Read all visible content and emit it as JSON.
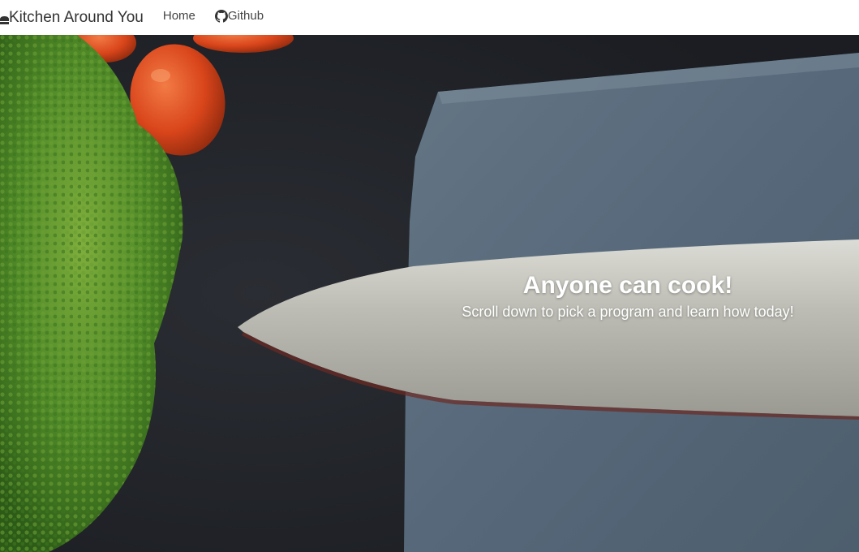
{
  "nav": {
    "brand_label": "Kitchen Around You",
    "brand_icon": "chef-hat-icon",
    "links": [
      {
        "label": "Home",
        "icon": null
      },
      {
        "label": "Github",
        "icon": "github-icon"
      }
    ]
  },
  "hero": {
    "title": "Anyone can cook!",
    "subtitle": "Scroll down to pick a program and learn how today!",
    "image": "broccoli, tomatoes and chef knife on slate board"
  },
  "colors": {
    "nav_bg": "#ffffff",
    "nav_text": "#444444",
    "hero_text": "#ffffff",
    "backdrop": "#1f2227",
    "slate": "#5a6b78"
  }
}
